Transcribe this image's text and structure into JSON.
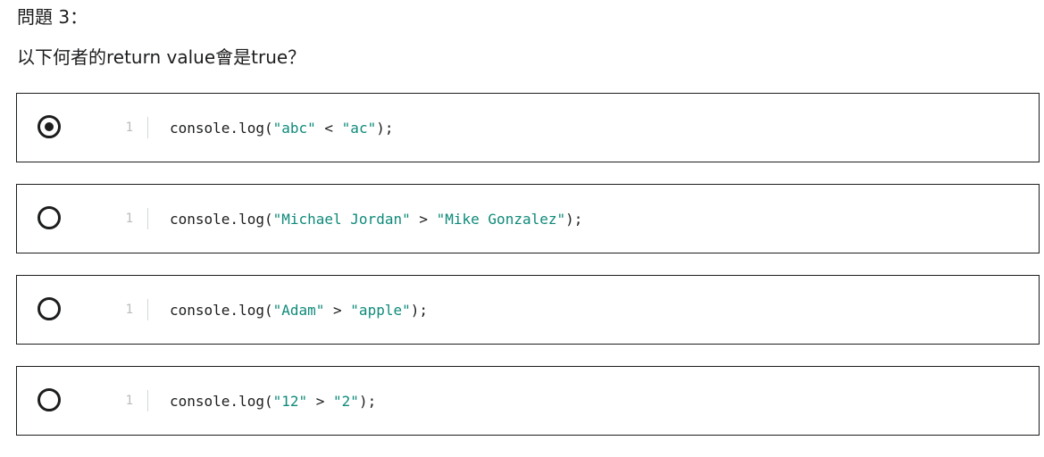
{
  "question": {
    "title": "問題 3：",
    "prompt": "以下何者的return value會是true？"
  },
  "options": [
    {
      "selected": true,
      "line_number": "1",
      "code": {
        "prefix": "console.log(",
        "left": "\"abc\"",
        "op": " < ",
        "right": "\"ac\"",
        "suffix": ");"
      }
    },
    {
      "selected": false,
      "line_number": "1",
      "code": {
        "prefix": "console.log(",
        "left": "\"Michael Jordan\"",
        "op": " > ",
        "right": "\"Mike Gonzalez\"",
        "suffix": ");"
      }
    },
    {
      "selected": false,
      "line_number": "1",
      "code": {
        "prefix": "console.log(",
        "left": "\"Adam\"",
        "op": " > ",
        "right": "\"apple\"",
        "suffix": ");"
      }
    },
    {
      "selected": false,
      "line_number": "1",
      "code": {
        "prefix": "console.log(",
        "left": "\"12\"",
        "op": " > ",
        "right": "\"2\"",
        "suffix": ");"
      }
    }
  ],
  "colors": {
    "text": "#1c1d1f",
    "string": "#0f8a7a",
    "line_number": "#b9bbbd",
    "border": "#1c1d1f"
  }
}
